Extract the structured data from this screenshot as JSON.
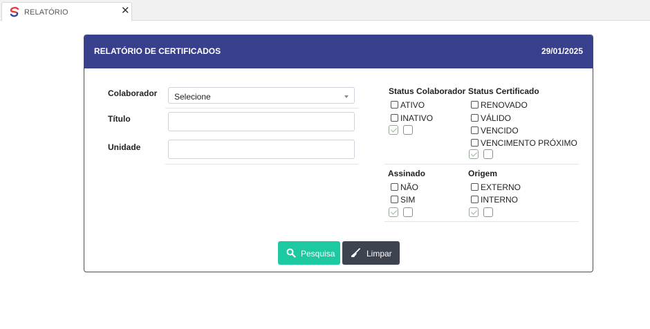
{
  "tab": {
    "title": "RELATÓRIO",
    "close": "✕"
  },
  "header": {
    "title": "RELATÓRIO DE CERTIFICADOS",
    "date": "29/01/2025"
  },
  "form": {
    "colaborador_label": "Colaborador",
    "colaborador_value": "Selecione",
    "titulo_label": "Título",
    "titulo_value": "",
    "unidade_label": "Unidade",
    "unidade_value": ""
  },
  "filters": {
    "status_colaborador": {
      "title": "Status Colaborador",
      "options": [
        "ATIVO",
        "INATIVO"
      ]
    },
    "status_certificado": {
      "title": "Status Certificado",
      "options": [
        "RENOVADO",
        "VÁLIDO",
        "VENCIDO",
        "VENCIMENTO PRÓXIMO"
      ]
    },
    "assinado": {
      "title": "Assinado",
      "options": [
        "NÃO",
        "SIM"
      ]
    },
    "origem": {
      "title": "Origem",
      "options": [
        "EXTERNO",
        "INTERNO"
      ]
    }
  },
  "buttons": {
    "search": "Pesquisa",
    "clear": "Limpar"
  },
  "colors": {
    "header": "#38408e",
    "search": "#1dc9a0",
    "clear": "#3e4350",
    "logo_red": "#e03d3d",
    "logo_blue": "#3a4a9a"
  },
  "icons": {
    "search": "search-icon",
    "clear": "broom-icon",
    "logo": "app-logo-icon"
  }
}
